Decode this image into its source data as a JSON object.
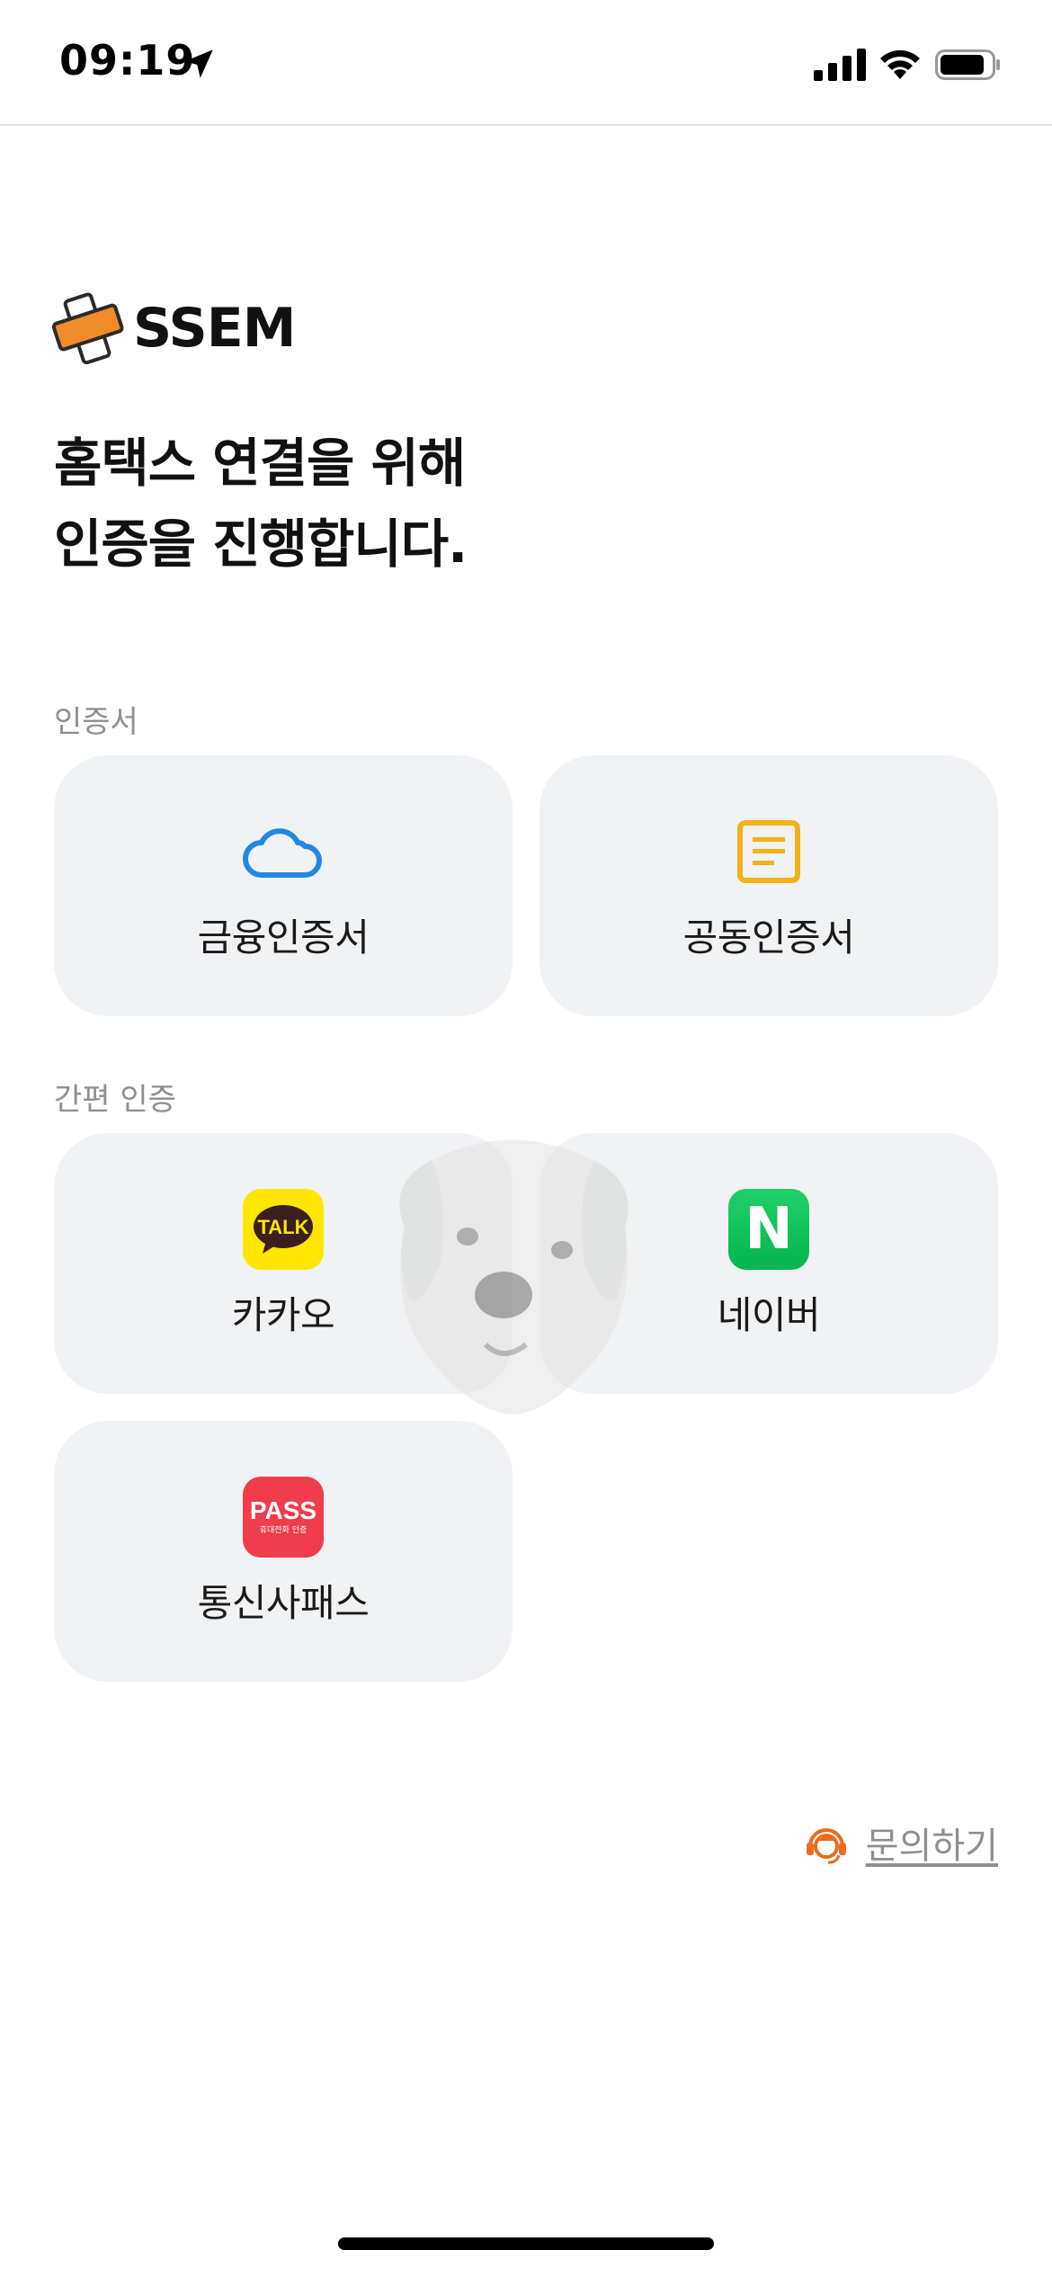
{
  "status_bar": {
    "time": "09:19"
  },
  "brand": {
    "name": "SSEM",
    "accent": "#f28b2a"
  },
  "headline": {
    "line1": "홈택스 연결을 위해",
    "line2": "인증을 진행합니다."
  },
  "sections": {
    "certificate": {
      "label": "인증서",
      "items": [
        {
          "label": "금융인증서",
          "icon": "cloud-icon",
          "color": "#1e88e5"
        },
        {
          "label": "공동인증서",
          "icon": "document-icon",
          "color": "#f2b21b"
        }
      ]
    },
    "simple_auth": {
      "label": "간편 인증",
      "items": [
        {
          "label": "카카오",
          "icon": "kakao-talk-icon",
          "badge_text": "TALK",
          "color": "#ffe600"
        },
        {
          "label": "네이버",
          "icon": "naver-icon",
          "badge_text": "N",
          "color": "#03c75a"
        },
        {
          "label": "통신사패스",
          "icon": "pass-icon",
          "badge_text": "PASS",
          "badge_sub": "휴대전화 인증",
          "color": "#ef3d4b"
        }
      ]
    }
  },
  "inquiry": {
    "label": "문의하기",
    "icon": "support-agent-icon",
    "color": "#ee6a1f"
  }
}
